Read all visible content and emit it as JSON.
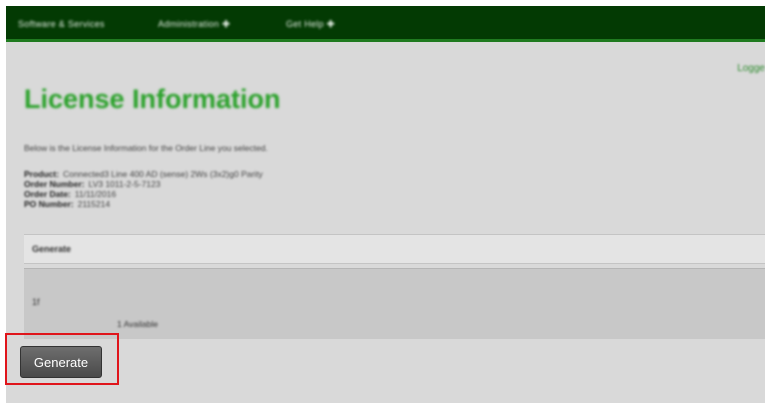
{
  "nav": {
    "items": [
      {
        "label": "Software & Services",
        "has_plus": false
      },
      {
        "label": "Administration",
        "has_plus": true
      },
      {
        "label": "Get Help",
        "has_plus": true
      }
    ],
    "plus_symbol": "✚"
  },
  "user": {
    "logged_label": "Logge"
  },
  "page": {
    "title": "License Information",
    "intro": "Below is the License Information for the Order Line you selected."
  },
  "details": [
    {
      "label": "Product:",
      "value": "Connected3 Line 400 AD (sense) 2Ws (3x2)g0 Parity"
    },
    {
      "label": "Order Number:",
      "value": "LV3 1011-2-5-7123"
    },
    {
      "label": "Order Date:",
      "value": "11/11/2016"
    },
    {
      "label": "PO Number:",
      "value": "2115214"
    }
  ],
  "section": {
    "label": "Generate"
  },
  "generate_panel": {
    "item_number": "1f",
    "available": "1 Available"
  },
  "generate_button": {
    "label": "Generate"
  },
  "colors": {
    "nav_bg": "#033a03",
    "title_green": "#2aa12a",
    "highlight_red": "#e0151b",
    "button_bg": "#5a5a5a"
  }
}
